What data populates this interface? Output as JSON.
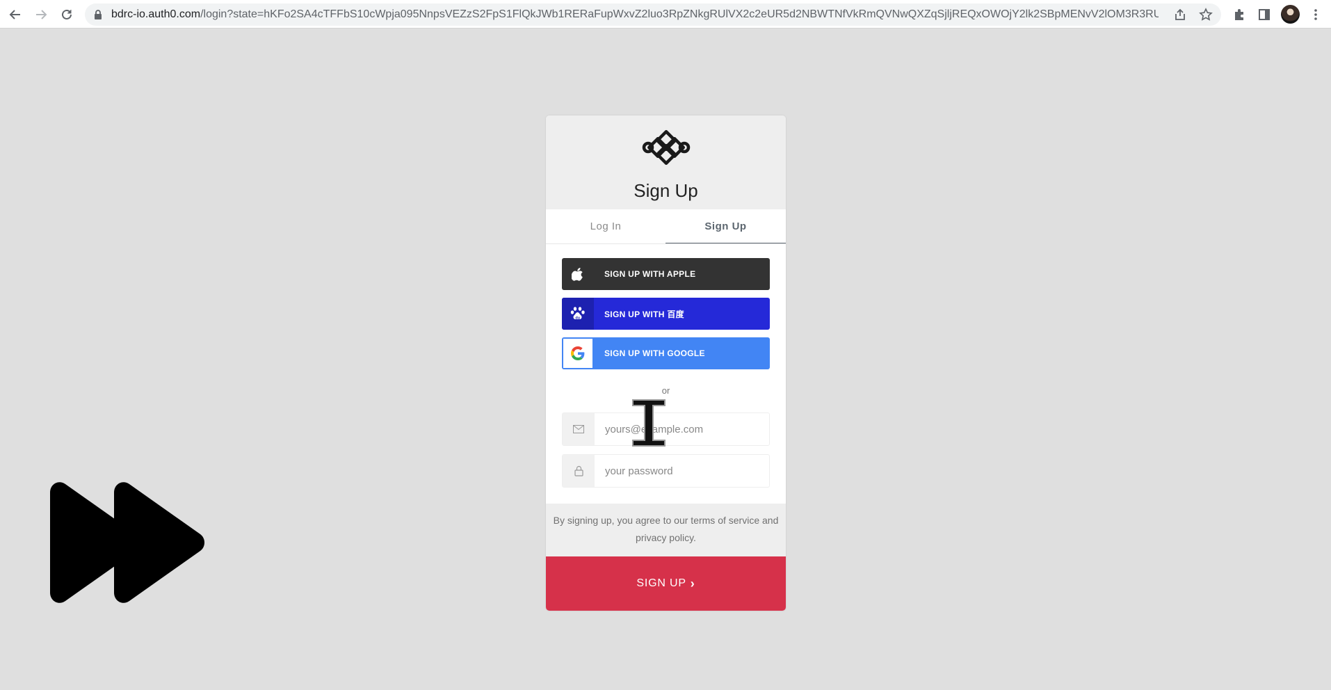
{
  "browser": {
    "url_host": "bdrc-io.auth0.com",
    "url_path": "/login?state=hKFo2SA4cTFFbS10cWpja095NnpsVEZzS2FpS1FlQkJWb1RERaFupWxvZ2luo3RpZNkgRUlVX2c2eUR5d2NBWTNfVkRmQVNwQXZqSjljREQxOWOjY2lk2SBpMENvV2lOM3R3RU1QQ0E4..."
  },
  "card": {
    "title": "Sign Up",
    "tabs": [
      {
        "label": "Log In",
        "active": false
      },
      {
        "label": "Sign Up",
        "active": true
      }
    ],
    "social": {
      "apple_label": "SIGN UP WITH APPLE",
      "baidu_label": "SIGN UP WITH 百度",
      "google_label": "SIGN UP WITH GOOGLE"
    },
    "separator": "or",
    "email_placeholder": "yours@example.com",
    "password_placeholder": "your password",
    "terms": "By signing up, you agree to our terms of service and privacy policy.",
    "submit_label": "SIGN UP",
    "submit_chevron": "›"
  },
  "colors": {
    "page_background": "#dfdfdf",
    "apple": "#333333",
    "baidu": "#2529d8",
    "google": "#4285f4",
    "submit": "#d6314a"
  },
  "icons": {
    "overlay_cursor": "text-cursor-ibeam-icon",
    "overlay_media": "fast-forward-icon"
  }
}
